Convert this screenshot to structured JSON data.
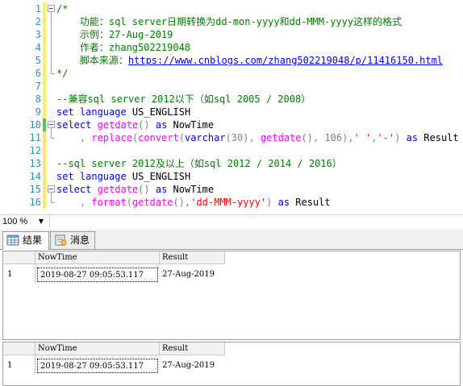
{
  "editor": {
    "lines": [
      {
        "num": "1",
        "marker": "saved",
        "fold": "start",
        "tokens": [
          {
            "t": "/*",
            "c": "com"
          }
        ]
      },
      {
        "num": "2",
        "marker": "saved",
        "fold": "line",
        "tokens": [
          {
            "t": "    功能：sql server日期转换为dd-mon-yyyy和dd-MMM-yyyy这样的格式",
            "c": "com"
          }
        ]
      },
      {
        "num": "3",
        "marker": "saved",
        "fold": "line",
        "tokens": [
          {
            "t": "    示例：27-Aug-2019",
            "c": "com"
          }
        ]
      },
      {
        "num": "4",
        "marker": "saved",
        "fold": "line",
        "tokens": [
          {
            "t": "    作者：zhang502219048",
            "c": "com"
          }
        ]
      },
      {
        "num": "5",
        "marker": "saved",
        "fold": "line",
        "tokens": [
          {
            "t": "    脚本来源：",
            "c": "com"
          },
          {
            "t": "https://www.cnblogs.com/zhang502219048/p/11416150.html",
            "c": "link"
          }
        ]
      },
      {
        "num": "6",
        "marker": "saved",
        "fold": "end",
        "tokens": [
          {
            "t": "*/",
            "c": "com"
          }
        ]
      },
      {
        "num": "7",
        "marker": "saved",
        "fold": "none",
        "tokens": []
      },
      {
        "num": "8",
        "marker": "saved",
        "fold": "none",
        "tokens": [
          {
            "t": "--兼容sql server 2012以下（如sql 2005 / 2008）",
            "c": "com"
          }
        ]
      },
      {
        "num": "9",
        "marker": "saved",
        "fold": "none",
        "tokens": [
          {
            "t": "set language ",
            "c": "kw"
          },
          {
            "t": "US_ENGLISH",
            "c": "plain"
          }
        ]
      },
      {
        "num": "10",
        "marker": "modified",
        "fold": "start",
        "tokens": [
          {
            "t": "select ",
            "c": "kw"
          },
          {
            "t": "getdate",
            "c": "fn"
          },
          {
            "t": "() ",
            "c": "op"
          },
          {
            "t": "as ",
            "c": "kw"
          },
          {
            "t": "NowTime",
            "c": "plain"
          }
        ]
      },
      {
        "num": "11",
        "marker": "saved2",
        "fold": "end",
        "tokens": [
          {
            "t": "    , ",
            "c": "op"
          },
          {
            "t": "replace",
            "c": "fn"
          },
          {
            "t": "(",
            "c": "op"
          },
          {
            "t": "convert",
            "c": "fn"
          },
          {
            "t": "(",
            "c": "op"
          },
          {
            "t": "varchar",
            "c": "kw"
          },
          {
            "t": "(30), ",
            "c": "op"
          },
          {
            "t": "getdate",
            "c": "fn"
          },
          {
            "t": "(), 106),",
            "c": "op"
          },
          {
            "t": "' '",
            "c": "str"
          },
          {
            "t": ",",
            "c": "op"
          },
          {
            "t": "'-'",
            "c": "str"
          },
          {
            "t": ") ",
            "c": "op"
          },
          {
            "t": "as ",
            "c": "kw"
          },
          {
            "t": "Result",
            "c": "plain"
          }
        ]
      },
      {
        "num": "12",
        "marker": "saved2",
        "fold": "none",
        "tokens": []
      },
      {
        "num": "13",
        "marker": "saved2",
        "fold": "none",
        "tokens": [
          {
            "t": "--sql server 2012及以上（如sql 2012 / 2014 / 2016）",
            "c": "com"
          }
        ]
      },
      {
        "num": "14",
        "marker": "saved2",
        "fold": "none",
        "tokens": [
          {
            "t": "set language ",
            "c": "kw"
          },
          {
            "t": "US_ENGLISH",
            "c": "plain"
          }
        ]
      },
      {
        "num": "15",
        "marker": "saved2",
        "fold": "start",
        "tokens": [
          {
            "t": "select ",
            "c": "kw"
          },
          {
            "t": "getdate",
            "c": "fn"
          },
          {
            "t": "() ",
            "c": "op"
          },
          {
            "t": "as ",
            "c": "kw"
          },
          {
            "t": "NowTime",
            "c": "plain"
          }
        ]
      },
      {
        "num": "16",
        "marker": "saved2",
        "fold": "end",
        "tokens": [
          {
            "t": "    , ",
            "c": "op"
          },
          {
            "t": "format",
            "c": "fn"
          },
          {
            "t": "(",
            "c": "op"
          },
          {
            "t": "getdate",
            "c": "fn"
          },
          {
            "t": "(),",
            "c": "op"
          },
          {
            "t": "'dd-MMM-yyyy'",
            "c": "str"
          },
          {
            "t": ") ",
            "c": "op"
          },
          {
            "t": "as ",
            "c": "kw"
          },
          {
            "t": "Result",
            "c": "plain"
          }
        ]
      }
    ]
  },
  "statusbar": {
    "zoom": "100 %"
  },
  "tabs": [
    {
      "label": "结果",
      "icon": "grid-icon",
      "active": true
    },
    {
      "label": "消息",
      "icon": "messages-icon",
      "active": false
    }
  ],
  "results": [
    {
      "columns": [
        "NowTime",
        "Result"
      ],
      "rows": [
        {
          "num": "1",
          "cells": [
            "2019-08-27 09:05:53.117",
            "27-Aug-2019"
          ]
        }
      ]
    },
    {
      "columns": [
        "NowTime",
        "Result"
      ],
      "rows": [
        {
          "num": "1",
          "cells": [
            "2019-08-27 09:05:53.117",
            "27-Aug-2019"
          ]
        }
      ]
    }
  ],
  "colors": {
    "comment": "#008000",
    "keyword": "#0000ff",
    "function": "#ff00ff",
    "string": "#ff0000",
    "operator": "#808080",
    "line_number": "#2b91af",
    "saved_marker": "#ffee62",
    "modified_marker": "#5cc15c"
  }
}
